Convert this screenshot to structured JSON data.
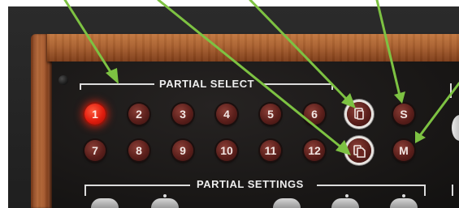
{
  "sections": {
    "partial_select": "PARTIAL SELECT",
    "partial_settings": "PARTIAL SETTINGS"
  },
  "partial_buttons": {
    "row1": [
      "1",
      "2",
      "3",
      "4",
      "5",
      "6"
    ],
    "row2": [
      "7",
      "8",
      "9",
      "10",
      "11",
      "12"
    ],
    "active": "1"
  },
  "function_buttons": {
    "solo_label": "S",
    "mute_label": "M",
    "copy_icon": "copy-icon",
    "paste_icon": "paste-icon"
  },
  "colors": {
    "active_led": "#e11d0e",
    "button_base": "#5b1f1b",
    "annotation_arrow": "#7dc242"
  }
}
